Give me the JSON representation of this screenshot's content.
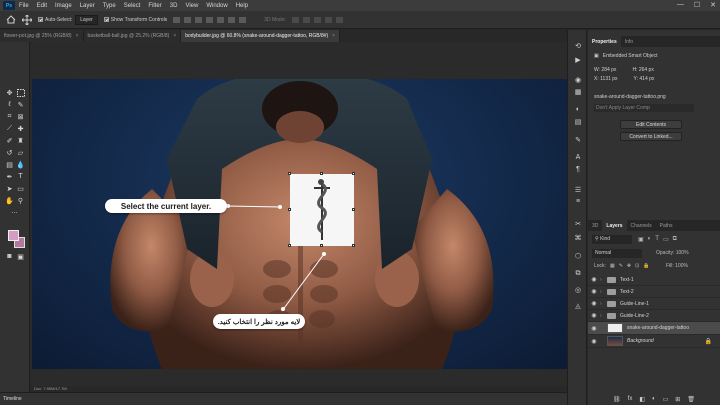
{
  "app": {
    "logo": "Ps",
    "menu": [
      "File",
      "Edit",
      "Image",
      "Layer",
      "Type",
      "Select",
      "Filter",
      "3D",
      "View",
      "Window",
      "Help"
    ],
    "window_controls": [
      "—",
      "☐",
      "✕"
    ]
  },
  "options_bar": {
    "auto_select_label": "Auto-Select:",
    "auto_select_checked": true,
    "target_value": "Layer",
    "show_transform_label": "Show Transform Controls",
    "show_transform_checked": true,
    "mode_label": "3D Mode:"
  },
  "tabs": [
    {
      "label": "flower-pot.jpg @ 25% (RGB/8)",
      "active": false
    },
    {
      "label": "basketball-ball.jpg @ 25.2% (RGB/8)",
      "active": false
    },
    {
      "label": "bodybuilder.jpg @ 60.8% (snake-around-dagger-tattoo, RGB/8#)",
      "active": true
    }
  ],
  "canvas": {
    "callout_en": "Select the current layer.",
    "callout_fa": "لایه مورد نظر را انتخاب کنید."
  },
  "status": {
    "doc_size": "Doc: 7.95M/17.7M"
  },
  "timeline": {
    "label": "Timeline"
  },
  "properties": {
    "tabs": [
      "Properties",
      "Info"
    ],
    "kind_label": "Embedded Smart Object",
    "w_label": "W:",
    "w_value": "284 px",
    "h_label": "H:",
    "h_value": "264 px",
    "x_label": "X:",
    "x_value": "1131 px",
    "y_label": "Y:",
    "y_value": "414 px",
    "source_file": "snake-around-dagger-tattoo.png",
    "layer_comp": "Don't Apply Layer Comp",
    "edit_contents": "Edit Contents",
    "convert_linked": "Convert to Linked..."
  },
  "layers_panel": {
    "tabs": [
      "3D",
      "Layers",
      "Channels",
      "Paths"
    ],
    "filter_kind": "Kind",
    "blend_mode": "Normal",
    "opacity_label": "Opacity:",
    "opacity_value": "100%",
    "lock_label": "Lock:",
    "fill_label": "Fill:",
    "fill_value": "100%",
    "layers": [
      {
        "name": "Text-1",
        "type": "group"
      },
      {
        "name": "Text-2",
        "type": "group"
      },
      {
        "name": "Guide-Line-1",
        "type": "group"
      },
      {
        "name": "Guide-Line-2",
        "type": "group"
      },
      {
        "name": "snake-around-dagger-tattoo",
        "type": "smart",
        "selected": true
      },
      {
        "name": "Background",
        "type": "image",
        "locked": true
      }
    ]
  },
  "colors": {
    "foreground": "#d79cc3",
    "background": "#b478a0",
    "accent": "#31a8ff"
  }
}
